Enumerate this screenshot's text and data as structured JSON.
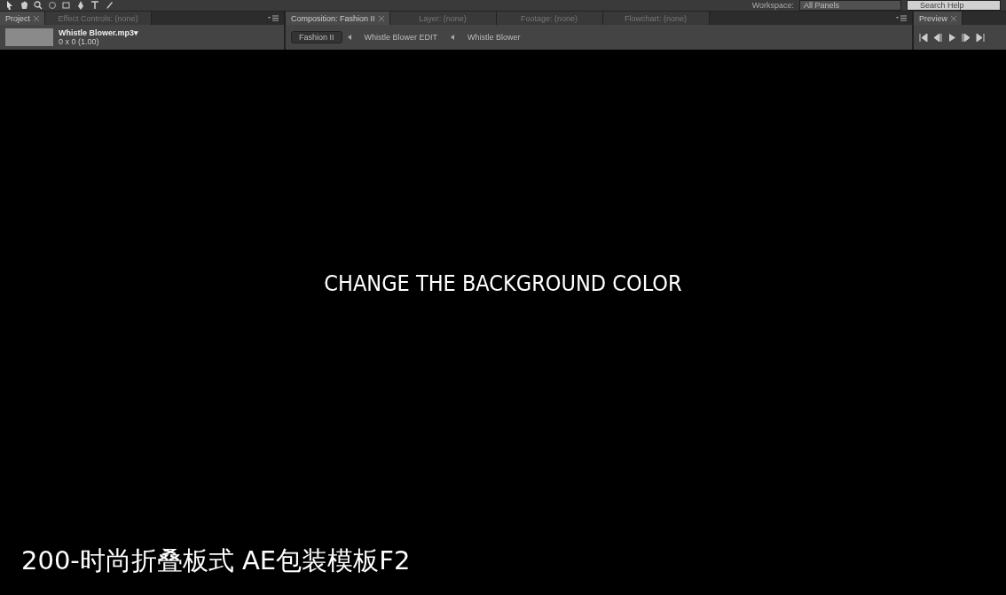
{
  "toolbar": {
    "workspace_label": "Workspace:",
    "workspace_value": "All Panels",
    "search": {
      "placeholder": "Search Help"
    }
  },
  "project_panel": {
    "tabs": [
      {
        "label": "Project",
        "selected": true
      },
      {
        "label": "Effect Controls: (none)",
        "selected": false
      }
    ],
    "item": {
      "name": "Whistle Blower.mp3▾",
      "info": "0 x 0 (1.00)"
    }
  },
  "composition_panel": {
    "tabs": [
      {
        "label": "Composition: Fashion II",
        "selected": true
      },
      {
        "label": "Layer: (none)",
        "selected": false
      },
      {
        "label": "Footage: (none)",
        "selected": false
      },
      {
        "label": "Flowchart: (none)",
        "selected": false
      }
    ],
    "breadcrumbs": [
      {
        "label": "Fashion II",
        "selected": true
      },
      {
        "label": "Whistle Blower EDIT",
        "selected": false
      },
      {
        "label": "Whistle Blower",
        "selected": false
      }
    ]
  },
  "preview_panel": {
    "tabs": [
      {
        "label": "Preview",
        "selected": true
      }
    ]
  },
  "viewer": {
    "text": "CHANGE THE BACKGROUND COLOR"
  },
  "caption": "200-时尚折叠板式 AE包装模板F2"
}
